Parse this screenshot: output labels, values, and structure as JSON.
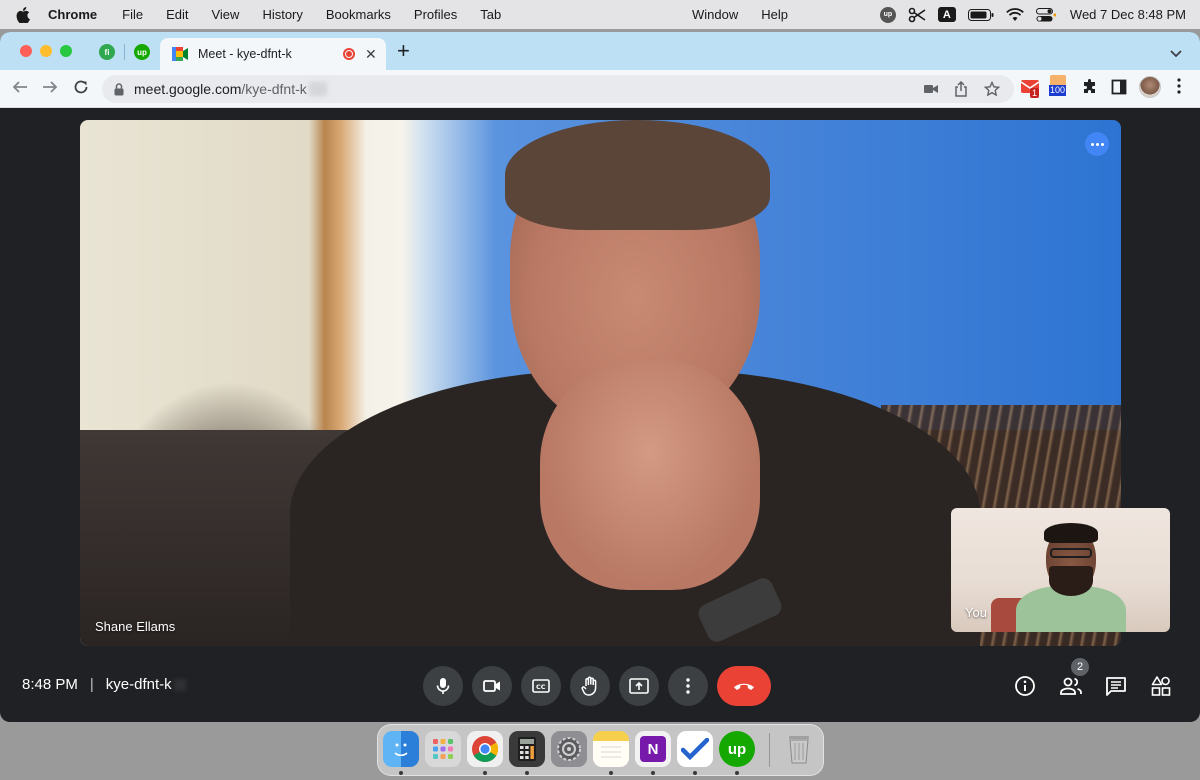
{
  "menubar": {
    "app_name": "Chrome",
    "items": [
      "File",
      "Edit",
      "View",
      "History",
      "Bookmarks",
      "Profiles",
      "Tab"
    ],
    "right_items": [
      "Window",
      "Help"
    ],
    "input_source": "A",
    "clock": "Wed 7 Dec  8:48 PM"
  },
  "browser": {
    "pinned_tabs": [
      {
        "icon": "fi-icon"
      },
      {
        "icon": "upwork-icon"
      }
    ],
    "active_tab": {
      "title": "Meet - kye-dfnt-k",
      "icon": "google-meet-icon",
      "recording": true
    },
    "url_host": "meet.google.com",
    "url_path": "/kye-dfnt-k",
    "extensions": {
      "gmail_count": "1",
      "counter_badge": "100"
    }
  },
  "meet": {
    "main_participant": "Shane Ellams",
    "self_label": "You",
    "time": "8:48 PM",
    "meeting_code": "kye-dfnt-k",
    "people_count": "2",
    "controls": [
      "mic-icon",
      "camera-icon",
      "captions-icon",
      "raise-hand-icon",
      "present-screen-icon",
      "more-options-icon",
      "end-call-icon"
    ],
    "side_controls": [
      "info-icon",
      "people-icon",
      "chat-icon",
      "activities-icon"
    ]
  },
  "colors": {
    "end_call": "#ea4335",
    "control_bg": "#3c4043",
    "meet_bg": "#202124",
    "tab_strip": "#bde0f5",
    "accent_blue": "#4285f4"
  },
  "dock": {
    "apps": [
      "Finder",
      "Launchpad",
      "Chrome",
      "Calculator",
      "System Preferences",
      "Notes",
      "OneNote",
      "Microsoft To Do",
      "Upwork",
      "Trash"
    ]
  }
}
